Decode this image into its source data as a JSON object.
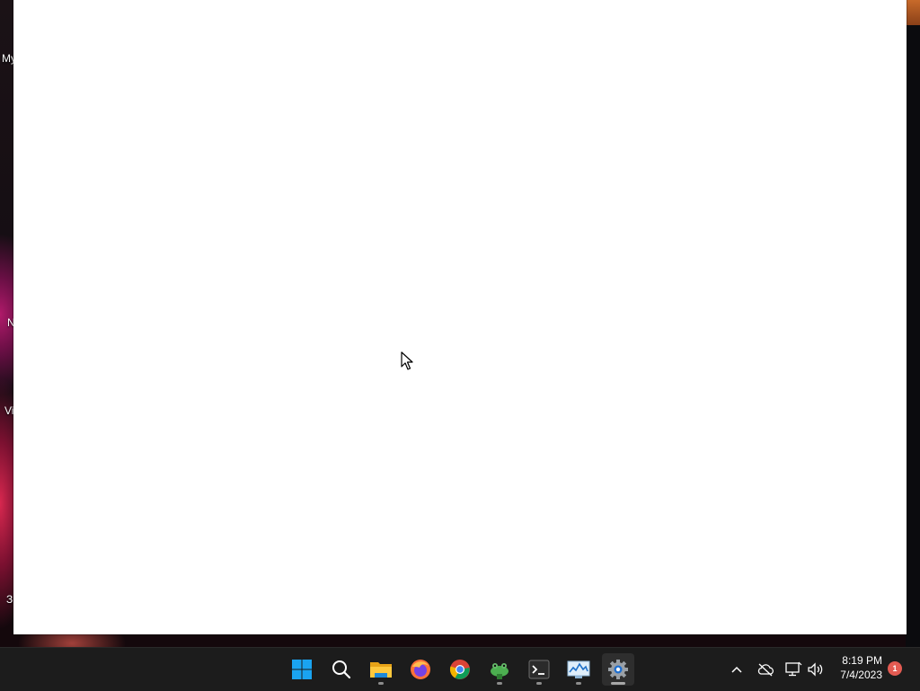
{
  "desktop": {
    "icon_labels": [
      "My",
      "N",
      "Vi",
      "З"
    ]
  },
  "taskbar": {
    "apps": [
      {
        "name": "start",
        "icon": "windows-logo-icon"
      },
      {
        "name": "search",
        "icon": "search-icon"
      },
      {
        "name": "file-explorer",
        "icon": "folder-icon"
      },
      {
        "name": "firefox",
        "icon": "firefox-icon"
      },
      {
        "name": "chrome",
        "icon": "chrome-icon"
      },
      {
        "name": "frog-app",
        "icon": "frog-icon"
      },
      {
        "name": "terminal",
        "icon": "terminal-icon"
      },
      {
        "name": "performance-monitor",
        "icon": "monitor-chart-icon"
      },
      {
        "name": "settings",
        "icon": "gear-icon"
      }
    ],
    "tray": {
      "icons": [
        "chevron-up-icon",
        "cloud-offline-icon",
        "network-icon",
        "volume-icon"
      ],
      "time": "8:19 PM",
      "date": "7/4/2023",
      "notification_count": "1"
    }
  },
  "colors": {
    "taskbar_bg": "#1c1c1c",
    "window_bg": "#ffffff",
    "notification_badge": "#e35b52"
  }
}
